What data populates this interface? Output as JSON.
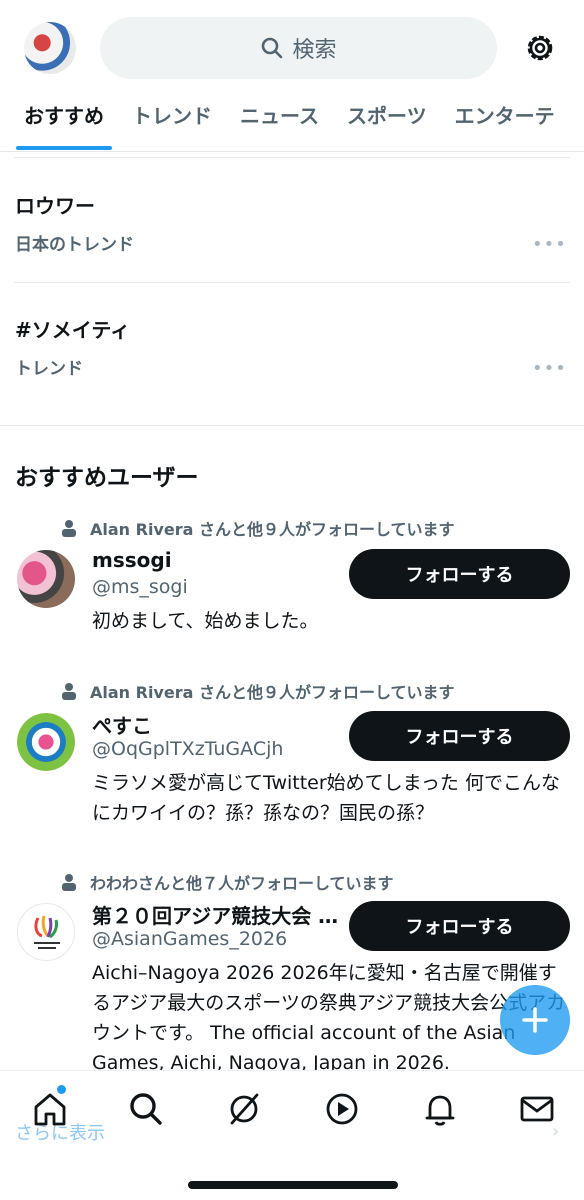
{
  "header": {
    "search_placeholder": "検索",
    "tabs": [
      "おすすめ",
      "トレンド",
      "ニュース",
      "スポーツ",
      "エンターテ"
    ]
  },
  "trends": [
    {
      "title": "ロウワー",
      "subtitle": "日本のトレンド"
    },
    {
      "title": "#ソメイティ",
      "subtitle": "トレンド"
    }
  ],
  "recommended": {
    "title": "おすすめユーザー",
    "follow_label": "フォローする",
    "users": [
      {
        "social": "Alan Rivera さんと他９人がフォローしています",
        "name": "mssogi",
        "handle": "@ms_sogi",
        "bio": "初めまして、始めました。"
      },
      {
        "social": "Alan Rivera さんと他９人がフォローしています",
        "name": "ぺすこ",
        "handle": "@OqGplTXzTuGACjh",
        "bio": "ミラソメ愛が高じてTwitter始めてしまった 何でこんなにカワイイの？孫？孫なの？国民の孫？"
      },
      {
        "social": "わわわさんと他７人がフォローしています",
        "name": "第２０回アジア競技大会 (…",
        "handle": "@AsianGames_2026",
        "bio": "Aichi–Nagoya 2026 2026年に愛知・名古屋で開催するアジア最大のスポーツの祭典アジア競技大会公式アカウントです。 The official account of the Asian Games, Aichi, Nagoya, Japan in 2026."
      }
    ]
  },
  "bottom": {
    "show_more": "さらに表示"
  },
  "colors": {
    "accent": "#1d9bf0",
    "text": "#0f1419",
    "muted": "#536471"
  }
}
